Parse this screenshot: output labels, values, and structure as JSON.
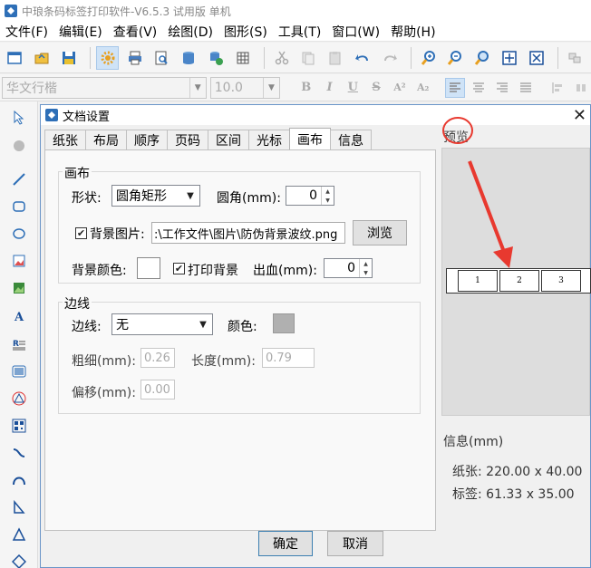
{
  "app": {
    "title": "中琅条码标签打印软件-V6.5.3 试用版 单机"
  },
  "menu": [
    "文件(F)",
    "编辑(E)",
    "查看(V)",
    "绘图(D)",
    "图形(S)",
    "工具(T)",
    "窗口(W)",
    "帮助(H)"
  ],
  "fontbar": {
    "font": "华文行楷",
    "size": "10.0"
  },
  "dialog": {
    "title": "文档设置",
    "tabs": [
      "纸张",
      "布局",
      "顺序",
      "页码",
      "区间",
      "光标",
      "画布",
      "信息"
    ],
    "active_tab": "画布",
    "canvas_group": {
      "title": "画布",
      "shape_label": "形状:",
      "shape_value": "圆角矩形",
      "radius_label": "圆角(mm):",
      "radius_value": "0",
      "bg_image_label": "背景图片:",
      "bg_image_path": ":\\工作文件\\图片\\防伪背景波纹.png",
      "browse_label": "浏览",
      "bg_color_label": "背景颜色:",
      "print_bg_label": "打印背景",
      "bleed_label": "出血(mm):",
      "bleed_value": "0"
    },
    "border_group": {
      "title": "边线",
      "border_label": "边线:",
      "border_value": "无",
      "color_label": "颜色:",
      "thickness_label": "粗细(mm):",
      "thickness_value": "0.26",
      "length_label": "长度(mm):",
      "length_value": "0.79",
      "offset_label": "偏移(mm):",
      "offset_value": "0.00"
    },
    "preview_title": "预览",
    "preview_cells": [
      "1",
      "2",
      "3"
    ],
    "info_title": "信息(mm)",
    "paper_info": "纸张: 220.00 x 40.00",
    "label_info": "标签: 61.33 x 35.00",
    "ok_label": "确定",
    "cancel_label": "取消"
  },
  "colors": {
    "accent": "#2e6fb7",
    "annotation": "#e8392f"
  }
}
